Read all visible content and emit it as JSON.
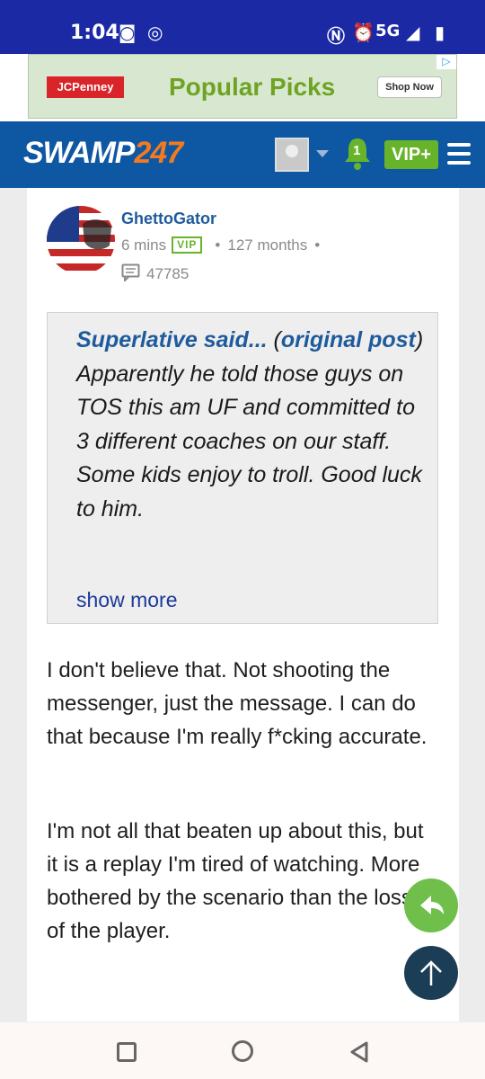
{
  "status_bar": {
    "time": "1:04",
    "network": "5G"
  },
  "ad": {
    "brand": "JCPenney",
    "headline": "Popular Picks",
    "cta": "Shop Now"
  },
  "header": {
    "logo_part1": "SWAMP",
    "logo_part2": "247",
    "notification_count": "1",
    "vip_label": "VIP+"
  },
  "post": {
    "username": "GhettoGator",
    "time_ago": "6 mins",
    "vip_badge": "VIP",
    "membership": "127 months",
    "post_count": "47785",
    "quote": {
      "author": "Superlative said...",
      "link_label": "original post",
      "text": "Apparently he told those guys on TOS this am UF and committed to 3 different coaches on our staff. Some kids enjoy to troll. Good luck to him.",
      "show_more": "show more"
    },
    "paragraphs": [
      "I don't believe that. Not shooting the messenger, just the message. I can do that because I'm really f*cking accurate.",
      "I'm not all that beaten up about this, but it is a replay I'm tired of watching. More bothered by the scenario than the loss of the player."
    ]
  },
  "colors": {
    "status_bar": "#1b29a4",
    "header": "#0e57a3",
    "vip_green": "#67b42a",
    "link_blue": "#1f5b9c",
    "accent_orange": "#f47a20"
  }
}
